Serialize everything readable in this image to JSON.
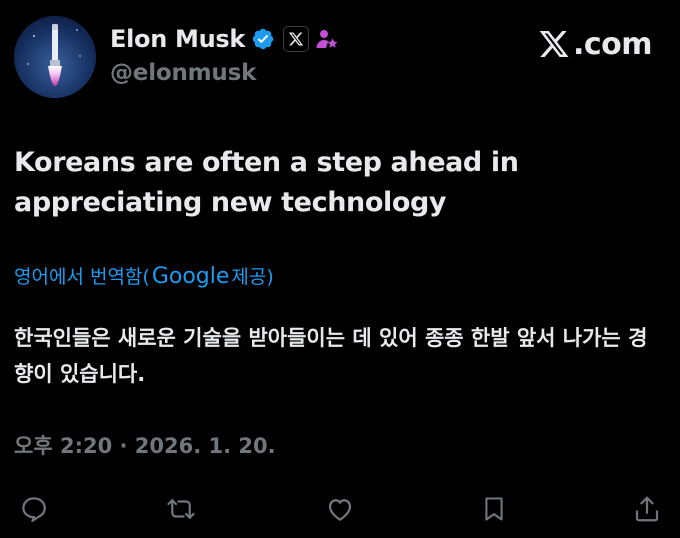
{
  "author": {
    "display_name": "Elon Musk",
    "handle": "@elonmusk",
    "verified": true,
    "affiliate_badge": "x-logo-badge",
    "extra_badge": "user-star-icon",
    "verified_color": "#1d9bf0",
    "extra_badge_color": "#c34fd6"
  },
  "brand": {
    "label": ".com",
    "icon": "x-logo-icon"
  },
  "post": {
    "text": "Koreans are often a step ahead in appreciating new technology",
    "translation_prefix": "영어에서 번역함(",
    "translation_provider": "Google",
    "translation_suffix": " 제공)",
    "translated_text": "한국인들은 새로운 기술을 받아들이는 데 있어 종종 한발 앞서 나가는 경향이 있습니다.",
    "timestamp": "오후 2:20 · 2026. 1. 20."
  },
  "actions": [
    {
      "name": "reply-icon"
    },
    {
      "name": "repost-icon"
    },
    {
      "name": "like-icon"
    },
    {
      "name": "bookmark-icon"
    },
    {
      "name": "share-icon"
    }
  ],
  "colors": {
    "background": "#000000",
    "text_primary": "#e7e9ea",
    "text_secondary": "#71767b",
    "link": "#1d9bf0"
  }
}
